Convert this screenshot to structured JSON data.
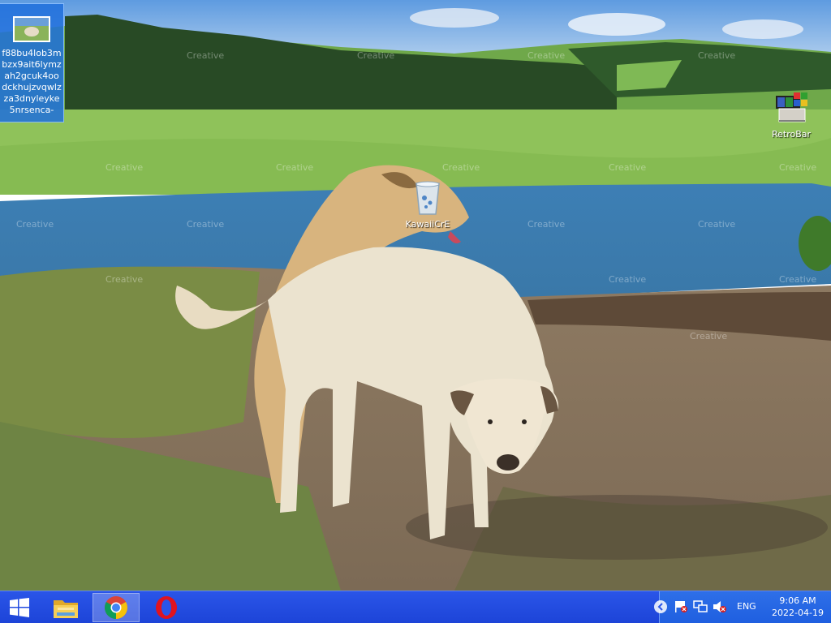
{
  "desktop": {
    "icons": [
      {
        "label": "f88bu4lob3mbzx9ait6lymzah2gcuk4oodckhujzvqwlzza3dnyleyke5nrsenca-",
        "icon": "image-file-icon"
      },
      {
        "label": "RetroBar",
        "icon": "retrobar-app-icon"
      },
      {
        "label": "KawaiiCrE",
        "icon": "glass-cup-icon"
      }
    ]
  },
  "taskbar": {
    "start": "windows-logo-icon",
    "pinned": [
      {
        "name": "file-explorer",
        "icon": "folder-icon"
      },
      {
        "name": "chrome",
        "icon": "chrome-icon"
      },
      {
        "name": "opera",
        "icon": "opera-icon"
      }
    ],
    "tray": {
      "lang": "ENG",
      "time": "9:06 AM",
      "date": "2022-04-19"
    }
  },
  "colors": {
    "taskbar": "#1d44d8",
    "tray": "#2465e6",
    "selection": "#1e6edc"
  }
}
